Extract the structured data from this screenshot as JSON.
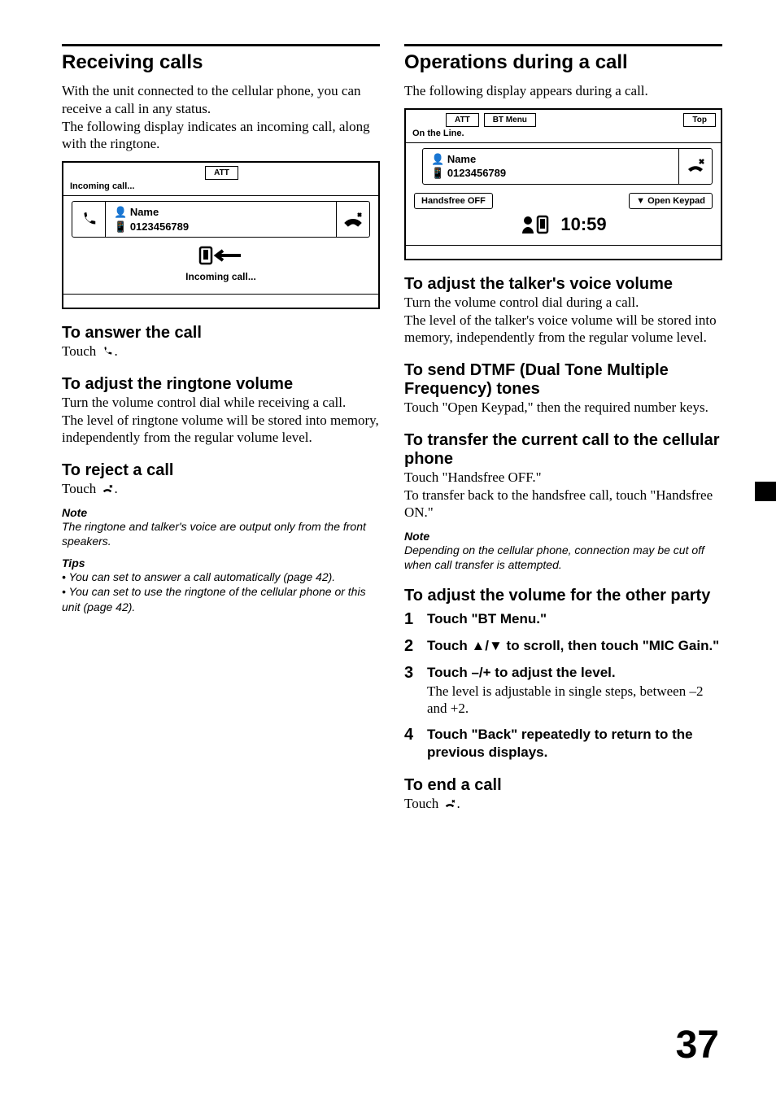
{
  "left": {
    "title": "Receiving calls",
    "intro1": "With the unit connected to the cellular phone, you can receive a call in any status.",
    "intro2": "The following display indicates an incoming call, along with the ringtone.",
    "screen": {
      "att": "ATT",
      "status": "Incoming call...",
      "name_label": "Name",
      "number": "0123456789",
      "center": "Incoming call..."
    },
    "h2a": "To answer the call",
    "p2a": "Touch ",
    "p2a_tail": ".",
    "h2b": "To adjust the ringtone volume",
    "p2b1": "Turn the volume control dial while receiving a call.",
    "p2b2": "The level of ringtone volume will be stored into memory, independently from the regular volume level.",
    "h2c": "To reject a call",
    "p2c": "Touch ",
    "p2c_tail": ".",
    "note_label": "Note",
    "note": "The ringtone and talker's voice are output only from the front speakers.",
    "tips_label": "Tips",
    "tip1": "You can set to answer a call automatically (page 42).",
    "tip2": "You can set to use the ringtone of the cellular phone or this unit (page 42)."
  },
  "right": {
    "title": "Operations during a call",
    "intro": "The following display appears during a call.",
    "screen": {
      "att": "ATT",
      "btmenu": "BT Menu",
      "top": "Top",
      "status": "On the Line.",
      "name_label": "Name",
      "number": "0123456789",
      "hf_off": "Handsfree OFF",
      "open_keypad": "▼ Open Keypad",
      "time": "10:59"
    },
    "h2a": "To adjust the talker's voice volume",
    "p2a1": "Turn the volume control dial during a call.",
    "p2a2": "The level of the talker's voice volume will be stored into memory, independently from the regular volume level.",
    "h2b": "To send DTMF (Dual Tone Multiple Frequency) tones",
    "p2b": "Touch \"Open Keypad,\" then the required number keys.",
    "h2c": "To transfer the current call to the cellular phone",
    "p2c1": "Touch \"Handsfree OFF.\"",
    "p2c2": "To transfer back to the handsfree call, touch \"Handsfree ON.\"",
    "note_label": "Note",
    "note": "Depending on the cellular phone, connection may be cut off when call transfer is attempted.",
    "h2d": "To adjust the volume for the other party",
    "s1": "Touch \"BT Menu.\"",
    "s2": "Touch ▲/▼ to scroll, then touch \"MIC Gain.\"",
    "s3a": "Touch –/+ to adjust the level.",
    "s3b": "The level is adjustable in single steps, between –2 and +2.",
    "s4": "Touch \"Back\" repeatedly to return to the previous displays.",
    "h2e": "To end a call",
    "p2e": "Touch ",
    "p2e_tail": "."
  },
  "page_number": "37"
}
